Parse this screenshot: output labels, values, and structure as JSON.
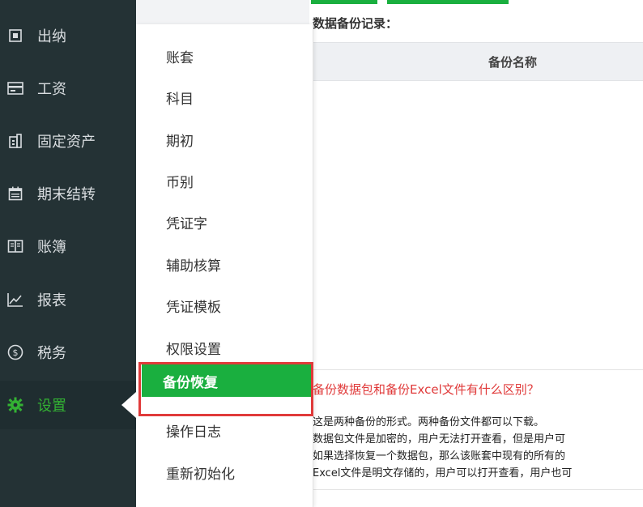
{
  "sidebar": {
    "items": [
      {
        "label": "出纳",
        "icon": "cashier-icon"
      },
      {
        "label": "工资",
        "icon": "salary-card-icon"
      },
      {
        "label": "固定资产",
        "icon": "building-icon"
      },
      {
        "label": "期末结转",
        "icon": "calendar-icon"
      },
      {
        "label": "账簿",
        "icon": "book-icon"
      },
      {
        "label": "报表",
        "icon": "chart-icon"
      },
      {
        "label": "税务",
        "icon": "tax-coin-icon"
      },
      {
        "label": "设置",
        "icon": "gear-icon"
      }
    ],
    "active_color": "#33b233"
  },
  "submenu": {
    "items": [
      {
        "label": "账套"
      },
      {
        "label": "科目"
      },
      {
        "label": "期初"
      },
      {
        "label": "币别"
      },
      {
        "label": "凭证字"
      },
      {
        "label": "辅助核算"
      },
      {
        "label": "凭证模板"
      },
      {
        "label": "权限设置"
      },
      {
        "label": "备份恢复"
      },
      {
        "label": "操作日志"
      },
      {
        "label": "重新初始化"
      }
    ],
    "selected": "备份恢复",
    "selected_color": "#1aaf3f",
    "highlight_color": "#e03a3a"
  },
  "main": {
    "records_title": "数据备份记录：",
    "table": {
      "columns": [
        "备份名称"
      ]
    },
    "faq": {
      "question": "备份数据包和备份Excel文件有什么区别？",
      "lines": [
        "这是两种备份的形式。两种备份文件都可以下载。",
        "数据包文件是加密的，用户无法打开查看，但是用户可",
        "如果选择恢复一个数据包，那么该账套中现有的所有的",
        "Excel文件是明文存储的，用户可以打开查看，用户也可"
      ]
    }
  }
}
